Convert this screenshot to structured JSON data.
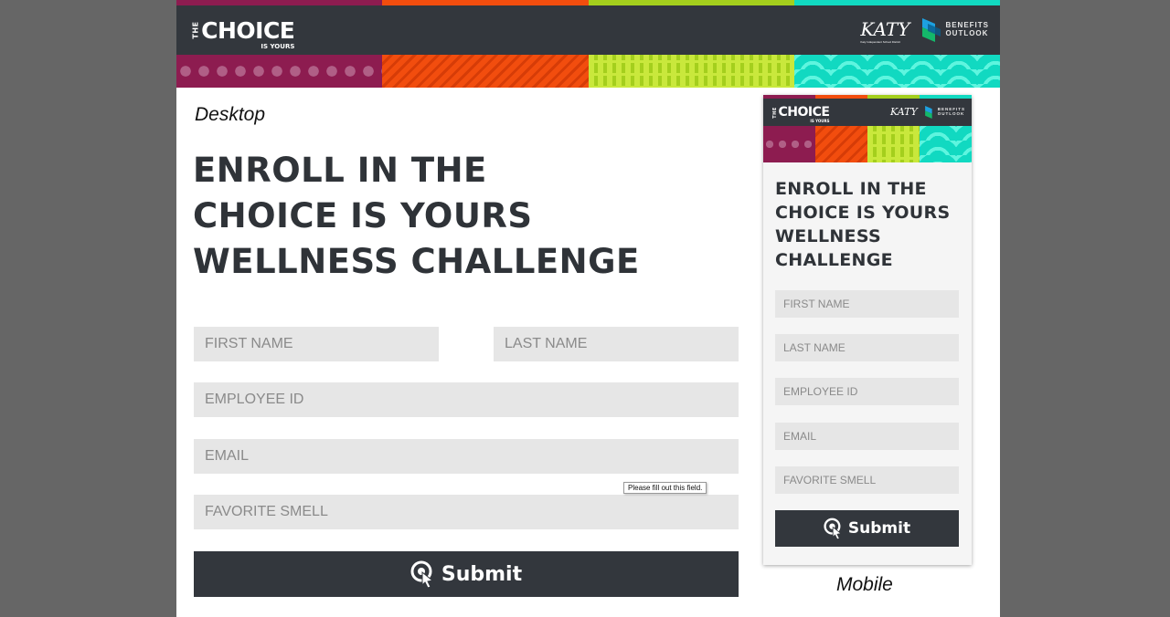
{
  "brand": {
    "logo_the": "THE",
    "logo_main": "CHOICE",
    "logo_sub": "IS YOURS",
    "partner1": "KATY",
    "partner1_sub": "Katy Independent School District",
    "partner2_line1": "BENEFITS",
    "partner2_line2": "OUTLOOK"
  },
  "colors": {
    "header_dark": "#33373d",
    "magenta": "#8d1c50",
    "orange": "#f24d0e",
    "lime": "#a4cf1d",
    "teal": "#11d9c1",
    "field_bg": "#e6e6e6",
    "title_text": "#2f3338"
  },
  "desktop": {
    "caption": "Desktop",
    "title_lines": [
      "ENROLL IN THE",
      "CHOICE IS YOURS",
      "WELLNESS CHALLENGE"
    ],
    "fields": {
      "first_name": "FIRST NAME",
      "last_name": "LAST NAME",
      "employee_id": "EMPLOYEE ID",
      "email": "EMAIL",
      "favorite_smell": "FAVORITE SMELL"
    },
    "tooltip": "Please fill out this field.",
    "submit_label": "Submit"
  },
  "mobile": {
    "caption": "Mobile",
    "title_lines": [
      "ENROLL IN THE",
      "CHOICE IS YOURS",
      "WELLNESS",
      "CHALLENGE"
    ],
    "fields": {
      "first_name": "FIRST NAME",
      "last_name": "LAST NAME",
      "employee_id": "EMPLOYEE ID",
      "email": "EMAIL",
      "favorite_smell": "FAVORITE SMELL"
    },
    "submit_label": "Submit"
  }
}
